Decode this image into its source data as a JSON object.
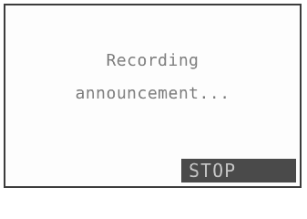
{
  "display": {
    "message_line_1": "Recording",
    "message_line_2": "announcement..."
  },
  "softkey": {
    "stop_label": "STOP"
  }
}
